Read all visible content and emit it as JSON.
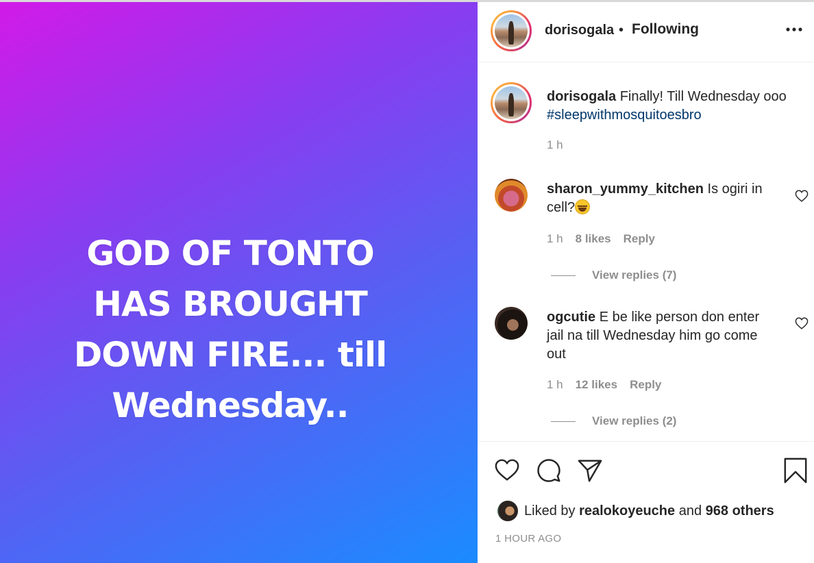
{
  "post": {
    "image_text": "GOD OF TONTO\nHAS BROUGHT\nDOWN FIRE... till\nWednesday.."
  },
  "header": {
    "username": "dorisogala",
    "separator": "•",
    "follow_status": "Following",
    "more_icon": "more-horizontal-icon"
  },
  "caption": {
    "username": "dorisogala",
    "text": "Finally! Till Wednesday ooo",
    "hashtag": "#sleepwithmosquitoesbro",
    "time": "1 h"
  },
  "comments": [
    {
      "username": "sharon_yummy_kitchen",
      "text": "Is ogiri in cell?",
      "emoji": "grinning-squint-face",
      "time": "1 h",
      "likes": "8 likes",
      "reply_label": "Reply",
      "view_replies": "View replies (7)"
    },
    {
      "username": "ogcutie",
      "text": "E be like person don enter jail na till Wednesday him go come out",
      "time": "1 h",
      "likes": "12 likes",
      "reply_label": "Reply",
      "view_replies": "View replies (2)"
    }
  ],
  "actions": {
    "like_icon": "heart-icon",
    "comment_icon": "comment-icon",
    "share_icon": "send-icon",
    "save_icon": "bookmark-icon"
  },
  "likes": {
    "prefix": "Liked by",
    "user": "realokoyeuche",
    "and": "and",
    "others": "968 others"
  },
  "timestamp": "1 HOUR AGO",
  "colors": {
    "hashtag": "#00376b",
    "muted": "#8e8e8e",
    "text": "#262626"
  }
}
